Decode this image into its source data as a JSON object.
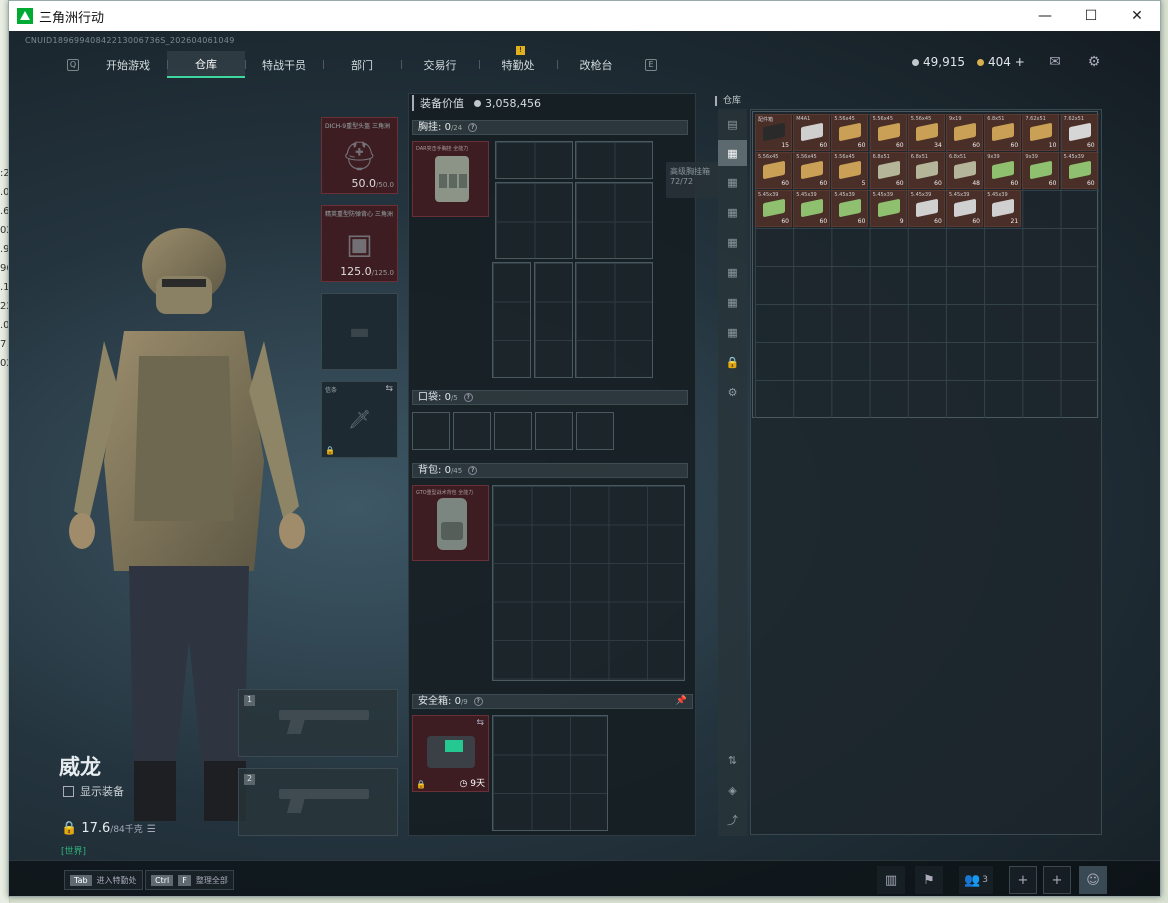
{
  "window": {
    "title": "三角洲行动",
    "controls": [
      "—",
      "☐",
      "✕"
    ]
  },
  "left_strip": [
    ":2",
    ".0",
    ".6",
    "02",
    ".9",
    "96",
    ".1",
    "22",
    ".0",
    "7",
    "02"
  ],
  "uid": "CNUID18969940842213006736S_202604061049",
  "nav": {
    "left_key": "Q",
    "right_key": "E",
    "tabs": [
      {
        "label": "开始游戏",
        "active": false
      },
      {
        "label": "仓库",
        "active": true
      },
      {
        "label": "特战干员",
        "active": false
      },
      {
        "label": "部门",
        "active": false
      },
      {
        "label": "交易行",
        "active": false
      },
      {
        "label": "特勤处",
        "active": false,
        "badge": "!"
      },
      {
        "label": "改枪台",
        "active": false
      }
    ]
  },
  "currency": {
    "silver": "49,915",
    "gold": "404",
    "gold_plus": "+"
  },
  "icons": {
    "mail": "mail-icon",
    "settings": "gear-icon"
  },
  "equipment_slots": {
    "helmet": {
      "name": "DICH-9重型头盔 三角洲",
      "value": "50.0",
      "max": "/50.0"
    },
    "armor": {
      "name": "精英重型防弹背心 三角洲",
      "value": "125.0",
      "max": "/125.0"
    },
    "pistol": {
      "name": ""
    },
    "melee": {
      "name": "信条"
    }
  },
  "gun_slots": [
    "1",
    "2"
  ],
  "character": {
    "name": "威龙",
    "show_gear": "显示装备",
    "weight": "17.6",
    "weight_max": "/84千克",
    "channel": "[世界]"
  },
  "gear_panel": {
    "title": "装备价值",
    "value": "3,058,456",
    "chest": {
      "label": "胸挂:",
      "count": "0",
      "cap": "/24",
      "item": "DAR突击手胸挂 全能力"
    },
    "pocket": {
      "label": "口袋:",
      "count": "0",
      "cap": "/5"
    },
    "backpack": {
      "label": "背包:",
      "count": "0",
      "cap": "/45",
      "item": "GTO重型战术背包 全能力"
    },
    "safebox": {
      "label": "安全箱:",
      "count": "0",
      "cap": "/9",
      "days": "9天"
    },
    "tooltip": [
      "高级胸挂箱",
      "72/72"
    ]
  },
  "storage": {
    "title": "仓库",
    "items": [
      {
        "name": "配件箱",
        "count": "15",
        "color": "#2a2a2a"
      },
      {
        "name": "M4A1",
        "count": "60",
        "color": "#cfcfcf"
      },
      {
        "name": "5.56x45",
        "count": "60",
        "color": "#c9a055"
      },
      {
        "name": "5.56x45",
        "count": "60",
        "color": "#c9a055"
      },
      {
        "name": "5.56x45",
        "count": "34",
        "color": "#c9a055"
      },
      {
        "name": "9x19",
        "count": "60",
        "color": "#c9a055"
      },
      {
        "name": "6.8x51",
        "count": "60",
        "color": "#c9a055"
      },
      {
        "name": "7.62x51",
        "count": "10",
        "color": "#c9a055"
      },
      {
        "name": "7.62x51",
        "count": "60",
        "color": "#d6d6d6"
      },
      {
        "name": "5.56x45",
        "count": "60",
        "color": "#c9a055"
      },
      {
        "name": "5.56x45",
        "count": "60",
        "color": "#c9a055"
      },
      {
        "name": "5.56x45",
        "count": "5",
        "color": "#c9a055"
      },
      {
        "name": "6.8x51",
        "count": "60",
        "color": "#b5b59a"
      },
      {
        "name": "6.8x51",
        "count": "60",
        "color": "#b5b59a"
      },
      {
        "name": "6.8x51",
        "count": "48",
        "color": "#b5b59a"
      },
      {
        "name": "9x39",
        "count": "60",
        "color": "#8fc070"
      },
      {
        "name": "9x39",
        "count": "60",
        "color": "#8fc070"
      },
      {
        "name": "5.45x39",
        "count": "60",
        "color": "#8fc070"
      },
      {
        "name": "5.45x39",
        "count": "60",
        "color": "#8fc070"
      },
      {
        "name": "5.45x39",
        "count": "60",
        "color": "#8fc070"
      },
      {
        "name": "5.45x39",
        "count": "60",
        "color": "#8fc070"
      },
      {
        "name": "5.45x39",
        "count": "9",
        "color": "#8fc070"
      },
      {
        "name": "5.45x39",
        "count": "60",
        "color": "#d0d0d0"
      },
      {
        "name": "5.45x39",
        "count": "60",
        "color": "#d0d0d0"
      },
      {
        "name": "5.45x39",
        "count": "21",
        "color": "#d0d0d0"
      }
    ]
  },
  "bottom": {
    "hint1_key": "Tab",
    "hint1_text": "进入特勤处",
    "hint2_key": "Ctrl",
    "hint2_key2": "F",
    "hint2_text": "整理全部",
    "friends": "3"
  }
}
